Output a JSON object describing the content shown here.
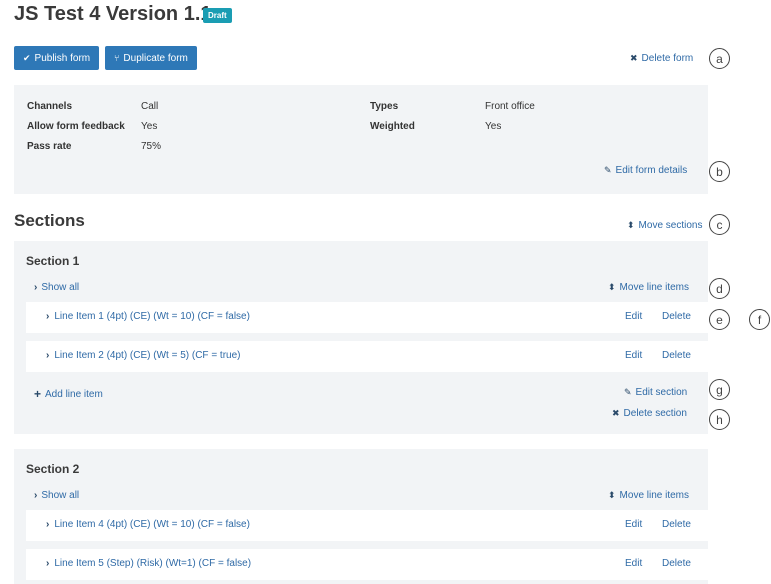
{
  "header": {
    "title": "JS Test 4 Version 1.1",
    "status_badge": "Draft"
  },
  "toolbar": {
    "publish_label": "Publish form",
    "duplicate_label": "Duplicate form",
    "delete_label": "Delete form"
  },
  "details": {
    "channels_label": "Channels",
    "channels_value": "Call",
    "feedback_label": "Allow form feedback",
    "feedback_value": "Yes",
    "passrate_label": "Pass rate",
    "passrate_value": "75%",
    "types_label": "Types",
    "types_value": "Front office",
    "weighted_label": "Weighted",
    "weighted_value": "Yes",
    "edit_label": "Edit form details"
  },
  "sections_heading": "Sections",
  "move_sections_label": "Move sections",
  "sections": [
    {
      "title": "Section 1",
      "show_all": "Show all",
      "move_line_items": "Move line items",
      "line_items": [
        {
          "label": "Line Item 1 (4pt) (CE) (Wt = 10) (CF = false)",
          "edit": "Edit",
          "delete": "Delete"
        },
        {
          "label": "Line Item 2 (4pt) (CE) (Wt = 5) (CF = true)",
          "edit": "Edit",
          "delete": "Delete"
        }
      ],
      "add_line_item": "Add line item",
      "edit_section": "Edit section",
      "delete_section": "Delete section"
    },
    {
      "title": "Section 2",
      "show_all": "Show all",
      "move_line_items": "Move line items",
      "line_items": [
        {
          "label": "Line Item 4 (4pt) (CE) (Wt = 10) (CF = false)",
          "edit": "Edit",
          "delete": "Delete"
        },
        {
          "label": "Line Item 5 (Step) (Risk) (Wt=1) (CF = false)",
          "edit": "Edit",
          "delete": "Delete"
        }
      ]
    }
  ],
  "callouts": [
    "a",
    "b",
    "c",
    "d",
    "e",
    "f",
    "g",
    "h"
  ],
  "icons": {
    "check": "check-icon",
    "duplicate": "duplicate-icon",
    "close": "close-icon",
    "pencil": "pencil-icon",
    "sort": "sort-icon",
    "chevron": "chevron-right-icon",
    "plus": "plus-icon"
  },
  "colors": {
    "primary_button": "#2e78b7",
    "badge": "#1a9db3",
    "link": "#2f6aa6",
    "panel": "#f2f4f6"
  }
}
